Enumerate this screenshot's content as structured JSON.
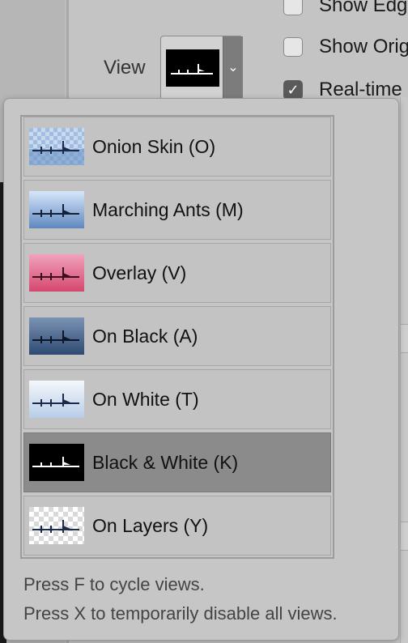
{
  "panel": {
    "view_label": "View",
    "view_select_arrow": "⌄",
    "checkboxes": [
      {
        "label": "Show Edg",
        "checked": false
      },
      {
        "label": "Show Orig",
        "checked": false
      },
      {
        "label": "Real-time",
        "checked": true
      }
    ]
  },
  "view_menu": {
    "items": [
      {
        "label": "Onion Skin (O)",
        "thumb": "onion-skin",
        "selected": false
      },
      {
        "label": "Marching Ants (M)",
        "thumb": "marching-ants",
        "selected": false
      },
      {
        "label": "Overlay (V)",
        "thumb": "overlay",
        "selected": false
      },
      {
        "label": "On Black (A)",
        "thumb": "on-black",
        "selected": false
      },
      {
        "label": "On White (T)",
        "thumb": "on-white",
        "selected": false
      },
      {
        "label": "Black & White (K)",
        "thumb": "black-and-white",
        "selected": true
      },
      {
        "label": "On Layers (Y)",
        "thumb": "on-layers",
        "selected": false
      }
    ],
    "hints": [
      "Press F to cycle views.",
      "Press X to temporarily disable all views."
    ]
  },
  "colors": {
    "selected_row": "#8b8b8b",
    "row": "#c3c3c3",
    "checkbox_checked": "#5a5a5a"
  }
}
